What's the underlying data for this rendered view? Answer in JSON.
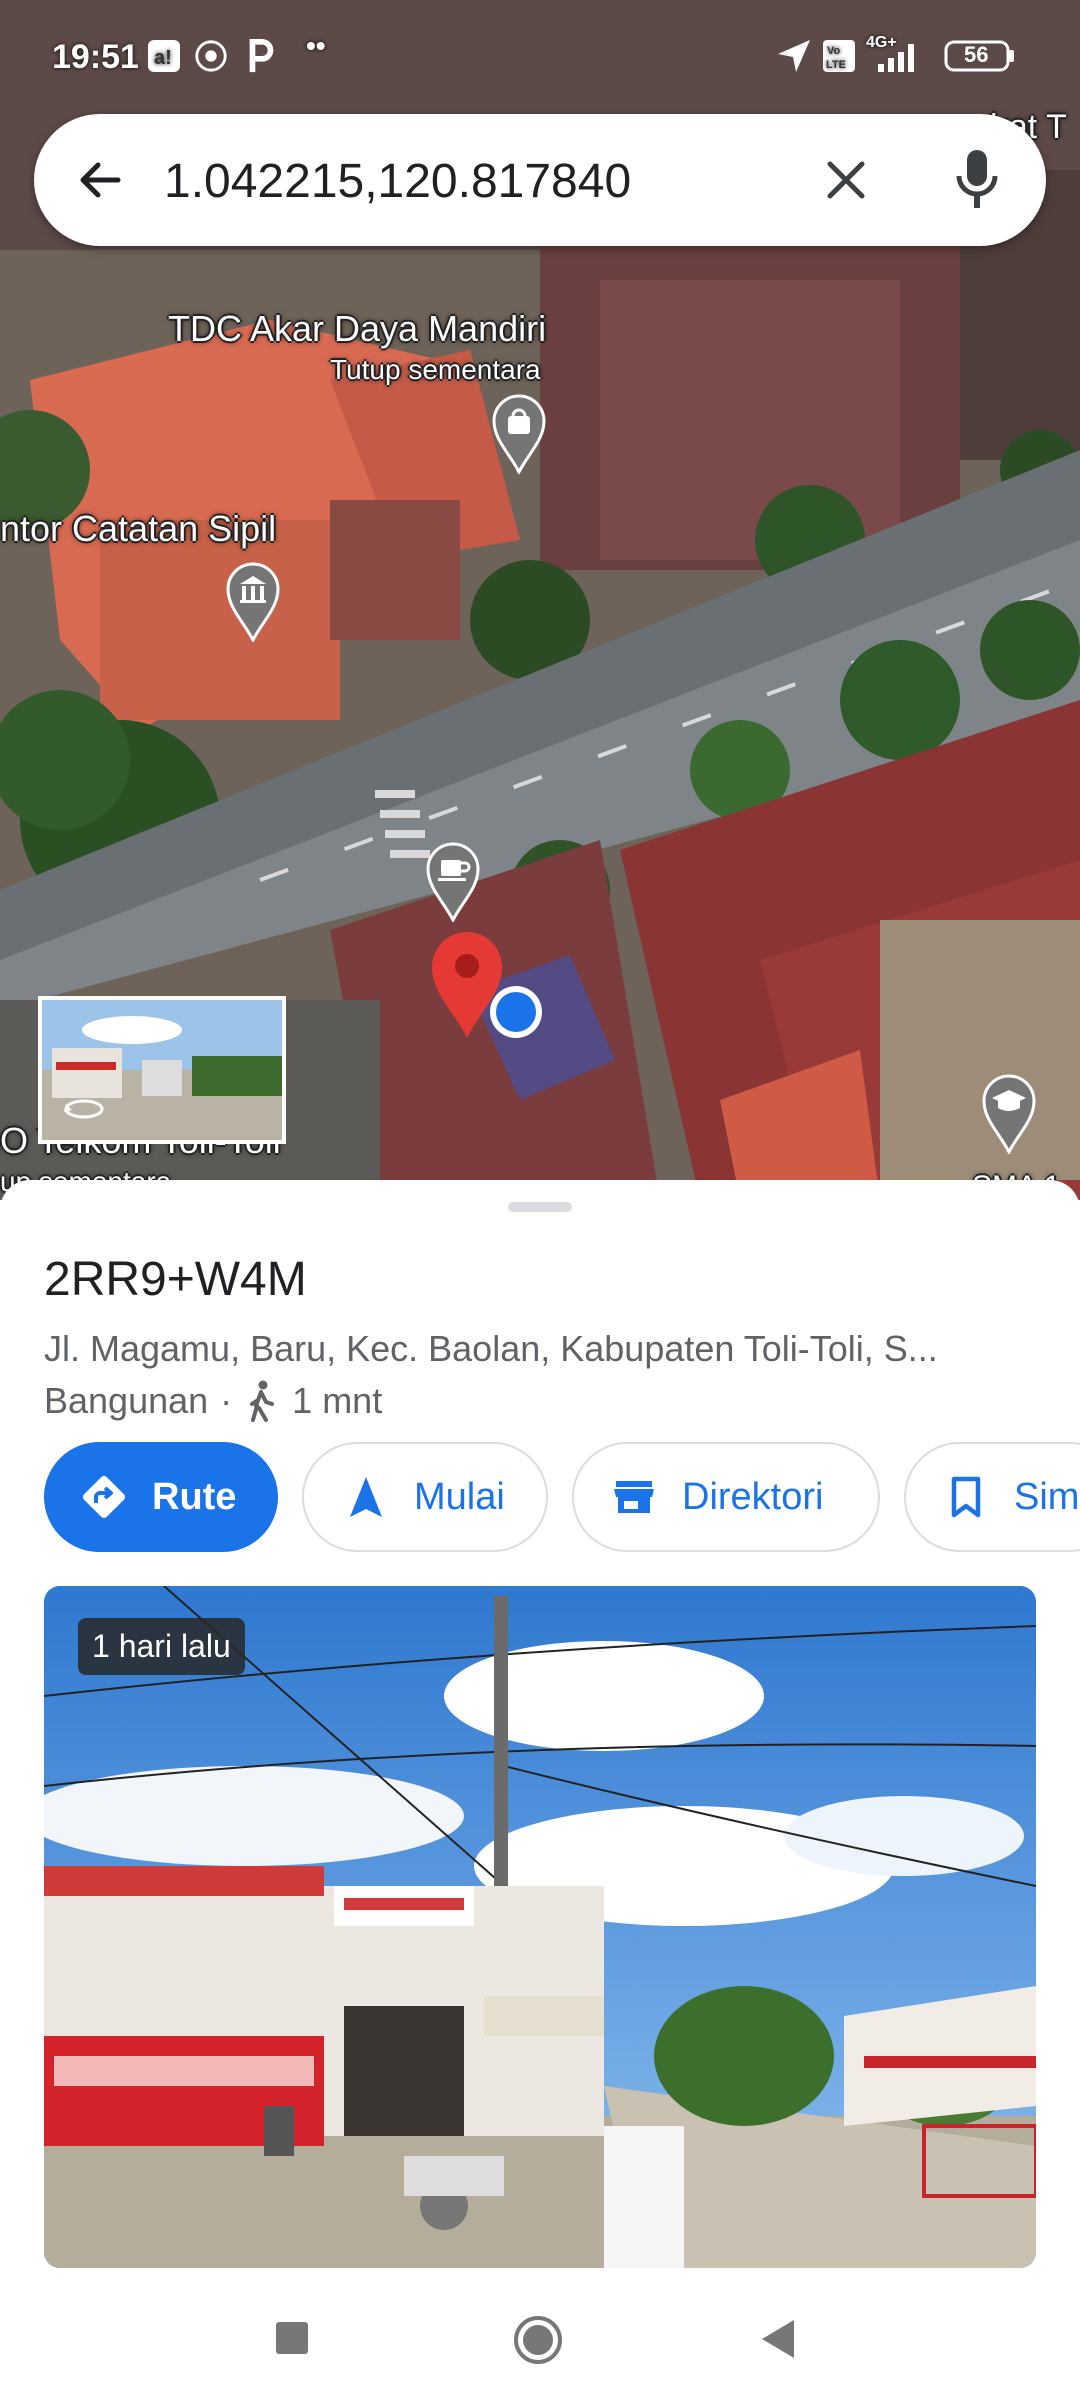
{
  "status_bar": {
    "time": "19:51",
    "battery": "56",
    "network": "4G+"
  },
  "search": {
    "query": "1.042215,120.817840"
  },
  "map": {
    "labels": {
      "poi_tdc": "TDC Akar Daya Mandiri",
      "poi_tdc_status": "Tutup sementara",
      "poi_catatan": "ntor Catatan Sipil",
      "poi_telkom": "O Telkom Toli-Toli",
      "poi_telkom_status": "up sementara",
      "poi_top_right": "irat T",
      "poi_bottom_right": "SMA 1"
    }
  },
  "place": {
    "title": "2RR9+W4M",
    "address": "Jl. Magamu, Baru, Kec. Baolan, Kabupaten Toli-Toli, S...",
    "category": "Bangunan",
    "separator": "·",
    "walk_time": "1 mnt"
  },
  "actions": {
    "route": "Rute",
    "start": "Mulai",
    "directory": "Direktori",
    "save": "Simp"
  },
  "photo": {
    "badge": "1 hari lalu"
  },
  "colors": {
    "accent": "#1a73e8",
    "pin_red": "#e53935",
    "location_blue": "#1a73e8"
  }
}
